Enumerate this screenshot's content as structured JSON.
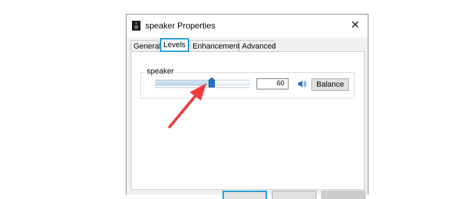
{
  "window": {
    "title": "speaker Properties",
    "close_glyph": "✕",
    "icon": "speaker-device-icon"
  },
  "tabs": [
    {
      "label": "General",
      "active": false
    },
    {
      "label": "Levels",
      "active": true
    },
    {
      "label": "Enhancements",
      "active": false
    },
    {
      "label": "Advanced",
      "active": false
    }
  ],
  "levels": {
    "group_label": "speaker",
    "volume_value": "60",
    "volume_level": 0.6,
    "mute_icon": "speaker-volume-icon",
    "balance_label": "Balance"
  },
  "annotation": {
    "arrow_color": "#f03c3c"
  },
  "colors": {
    "focus": "#1e9bd7",
    "thumb": "#1a73c8"
  }
}
